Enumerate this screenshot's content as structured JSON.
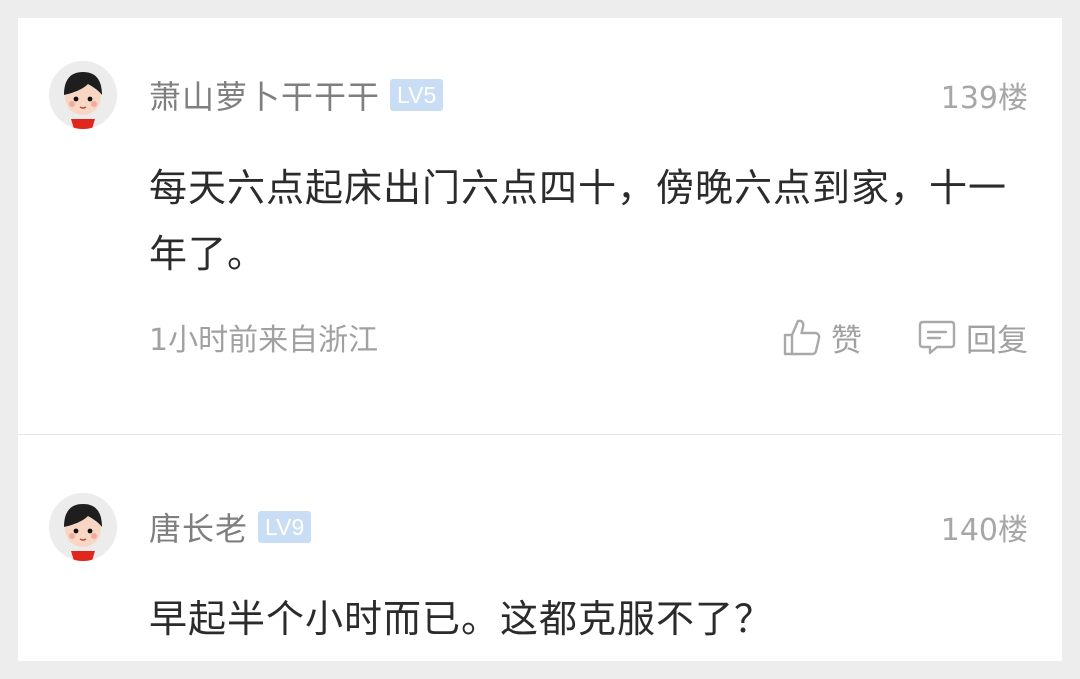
{
  "comments": [
    {
      "username": "萧山萝卜干干干",
      "level": "LV5",
      "floor": "139楼",
      "content": "每天六点起床出门六点四十，傍晚六点到家，十一年了。",
      "meta": "1小时前来自浙江",
      "like_label": "赞",
      "reply_label": "回复",
      "avatar_icon": "cartoon-avatar-icon"
    },
    {
      "username": "唐长老",
      "level": "LV9",
      "floor": "140楼",
      "content": "早起半个小时而已。这都克服不了？",
      "avatar_icon": "cartoon-avatar-icon"
    }
  ],
  "colors": {
    "background": "#ededed",
    "card": "#ffffff",
    "username": "#7f7f7f",
    "badge": "#c9ddf4",
    "text": "#2b2b2b",
    "muted": "#a1a1a1"
  }
}
